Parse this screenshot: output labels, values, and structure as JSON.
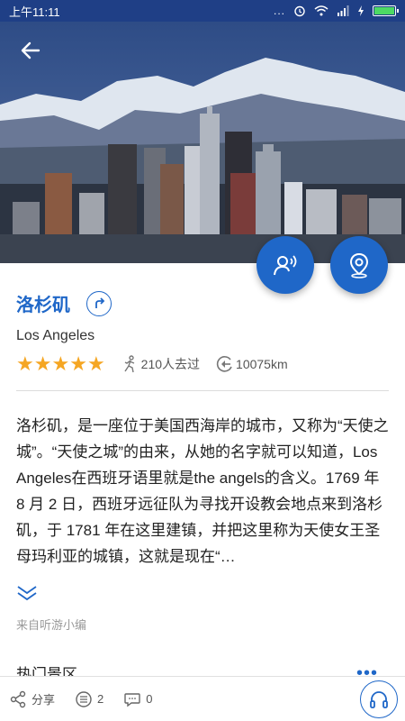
{
  "status_bar": {
    "time": "上午11:11",
    "dots": "..."
  },
  "hero": {
    "back_icon": "arrow-left-icon"
  },
  "fabs": {
    "guide_icon": "audio-guide-icon",
    "location_icon": "location-pin-icon"
  },
  "info": {
    "title": "洛杉矶",
    "subtitle": "Los Angeles",
    "rating": 5,
    "visitors": "210人去过",
    "distance": "10075km"
  },
  "description": {
    "text": "洛杉矶，是一座位于美国西海岸的城市，又称为“天使之城”。“天使之城”的由来，从她的名字就可以知道，Los Angeles在西班牙语里就是the angels的含义。1769 年 8 月 2 日，西班牙远征队为寻找开设教会地点来到洛杉矶，于 1781 年在这里建镇，并把这里称为天使女王圣母玛利亚的城镇，这就是现在“…",
    "source": "来自听游小编"
  },
  "section": {
    "title": "热门景区",
    "more": "•••"
  },
  "bottom_bar": {
    "share_label": "分享",
    "list_count": "2",
    "comment_count": "0"
  },
  "colors": {
    "accent": "#1f67c8",
    "status_bar": "#1f3f86",
    "star": "#f5a623"
  }
}
